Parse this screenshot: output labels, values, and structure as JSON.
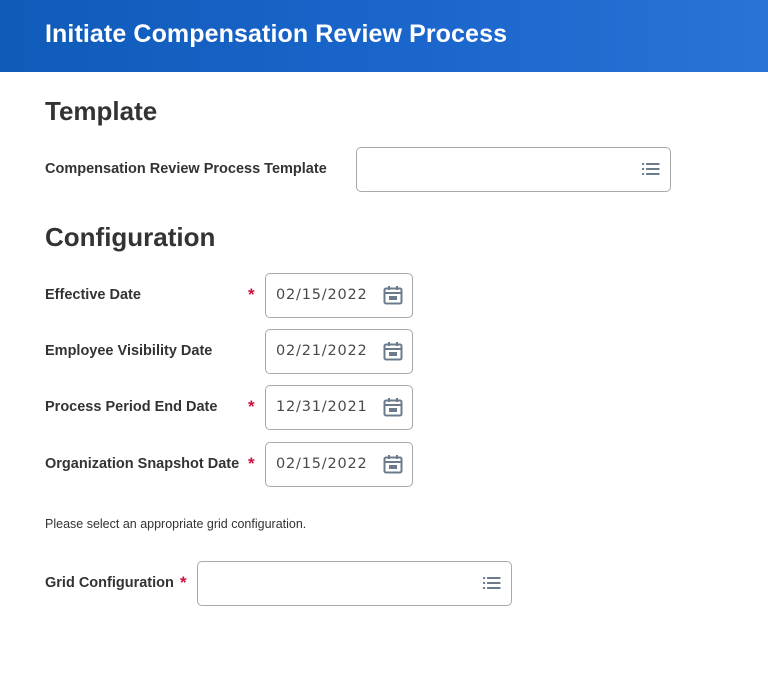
{
  "header": {
    "title": "Initiate Compensation Review Process"
  },
  "template_section": {
    "title": "Template",
    "fields": [
      {
        "label": "Compensation Review Process Template",
        "value": "",
        "icon": "prompt-list-icon",
        "required": false
      }
    ]
  },
  "configuration_section": {
    "title": "Configuration",
    "fields": [
      {
        "label": "Effective Date",
        "value": "02/15/2022",
        "required": true,
        "icon": "calendar-icon"
      },
      {
        "label": "Employee Visibility Date",
        "value": "02/21/2022",
        "required": false,
        "icon": "calendar-icon"
      },
      {
        "label": "Process Period End Date",
        "value": "12/31/2021",
        "required": true,
        "icon": "calendar-icon"
      },
      {
        "label": "Organization Snapshot Date",
        "value": "02/15/2022",
        "required": true,
        "icon": "calendar-icon"
      }
    ],
    "helper_text": "Please select an appropriate grid configuration.",
    "grid_configuration": {
      "label": "Grid Configuration",
      "value": "",
      "required": true,
      "icon": "prompt-list-icon"
    }
  },
  "required_marker": "*",
  "colors": {
    "header_start": "#0f5bb8",
    "header_end": "#2a73d6",
    "required": "#d0103a",
    "icon": "#6b7b8c",
    "border": "#a7a9ab"
  }
}
